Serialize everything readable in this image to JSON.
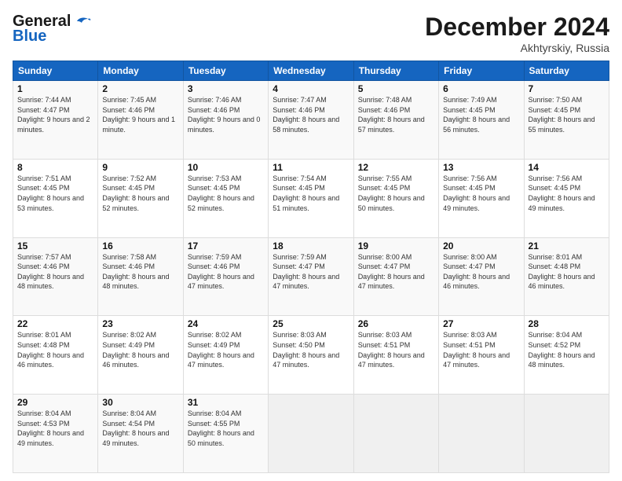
{
  "header": {
    "logo_line1": "General",
    "logo_line2": "Blue",
    "month": "December 2024",
    "location": "Akhtyrskiy, Russia"
  },
  "weekdays": [
    "Sunday",
    "Monday",
    "Tuesday",
    "Wednesday",
    "Thursday",
    "Friday",
    "Saturday"
  ],
  "weeks": [
    [
      {
        "day": "1",
        "sunrise": "Sunrise: 7:44 AM",
        "sunset": "Sunset: 4:47 PM",
        "daylight": "Daylight: 9 hours and 2 minutes."
      },
      {
        "day": "2",
        "sunrise": "Sunrise: 7:45 AM",
        "sunset": "Sunset: 4:46 PM",
        "daylight": "Daylight: 9 hours and 1 minute."
      },
      {
        "day": "3",
        "sunrise": "Sunrise: 7:46 AM",
        "sunset": "Sunset: 4:46 PM",
        "daylight": "Daylight: 9 hours and 0 minutes."
      },
      {
        "day": "4",
        "sunrise": "Sunrise: 7:47 AM",
        "sunset": "Sunset: 4:46 PM",
        "daylight": "Daylight: 8 hours and 58 minutes."
      },
      {
        "day": "5",
        "sunrise": "Sunrise: 7:48 AM",
        "sunset": "Sunset: 4:46 PM",
        "daylight": "Daylight: 8 hours and 57 minutes."
      },
      {
        "day": "6",
        "sunrise": "Sunrise: 7:49 AM",
        "sunset": "Sunset: 4:45 PM",
        "daylight": "Daylight: 8 hours and 56 minutes."
      },
      {
        "day": "7",
        "sunrise": "Sunrise: 7:50 AM",
        "sunset": "Sunset: 4:45 PM",
        "daylight": "Daylight: 8 hours and 55 minutes."
      }
    ],
    [
      {
        "day": "8",
        "sunrise": "Sunrise: 7:51 AM",
        "sunset": "Sunset: 4:45 PM",
        "daylight": "Daylight: 8 hours and 53 minutes."
      },
      {
        "day": "9",
        "sunrise": "Sunrise: 7:52 AM",
        "sunset": "Sunset: 4:45 PM",
        "daylight": "Daylight: 8 hours and 52 minutes."
      },
      {
        "day": "10",
        "sunrise": "Sunrise: 7:53 AM",
        "sunset": "Sunset: 4:45 PM",
        "daylight": "Daylight: 8 hours and 52 minutes."
      },
      {
        "day": "11",
        "sunrise": "Sunrise: 7:54 AM",
        "sunset": "Sunset: 4:45 PM",
        "daylight": "Daylight: 8 hours and 51 minutes."
      },
      {
        "day": "12",
        "sunrise": "Sunrise: 7:55 AM",
        "sunset": "Sunset: 4:45 PM",
        "daylight": "Daylight: 8 hours and 50 minutes."
      },
      {
        "day": "13",
        "sunrise": "Sunrise: 7:56 AM",
        "sunset": "Sunset: 4:45 PM",
        "daylight": "Daylight: 8 hours and 49 minutes."
      },
      {
        "day": "14",
        "sunrise": "Sunrise: 7:56 AM",
        "sunset": "Sunset: 4:45 PM",
        "daylight": "Daylight: 8 hours and 49 minutes."
      }
    ],
    [
      {
        "day": "15",
        "sunrise": "Sunrise: 7:57 AM",
        "sunset": "Sunset: 4:46 PM",
        "daylight": "Daylight: 8 hours and 48 minutes."
      },
      {
        "day": "16",
        "sunrise": "Sunrise: 7:58 AM",
        "sunset": "Sunset: 4:46 PM",
        "daylight": "Daylight: 8 hours and 48 minutes."
      },
      {
        "day": "17",
        "sunrise": "Sunrise: 7:59 AM",
        "sunset": "Sunset: 4:46 PM",
        "daylight": "Daylight: 8 hours and 47 minutes."
      },
      {
        "day": "18",
        "sunrise": "Sunrise: 7:59 AM",
        "sunset": "Sunset: 4:47 PM",
        "daylight": "Daylight: 8 hours and 47 minutes."
      },
      {
        "day": "19",
        "sunrise": "Sunrise: 8:00 AM",
        "sunset": "Sunset: 4:47 PM",
        "daylight": "Daylight: 8 hours and 47 minutes."
      },
      {
        "day": "20",
        "sunrise": "Sunrise: 8:00 AM",
        "sunset": "Sunset: 4:47 PM",
        "daylight": "Daylight: 8 hours and 46 minutes."
      },
      {
        "day": "21",
        "sunrise": "Sunrise: 8:01 AM",
        "sunset": "Sunset: 4:48 PM",
        "daylight": "Daylight: 8 hours and 46 minutes."
      }
    ],
    [
      {
        "day": "22",
        "sunrise": "Sunrise: 8:01 AM",
        "sunset": "Sunset: 4:48 PM",
        "daylight": "Daylight: 8 hours and 46 minutes."
      },
      {
        "day": "23",
        "sunrise": "Sunrise: 8:02 AM",
        "sunset": "Sunset: 4:49 PM",
        "daylight": "Daylight: 8 hours and 46 minutes."
      },
      {
        "day": "24",
        "sunrise": "Sunrise: 8:02 AM",
        "sunset": "Sunset: 4:49 PM",
        "daylight": "Daylight: 8 hours and 47 minutes."
      },
      {
        "day": "25",
        "sunrise": "Sunrise: 8:03 AM",
        "sunset": "Sunset: 4:50 PM",
        "daylight": "Daylight: 8 hours and 47 minutes."
      },
      {
        "day": "26",
        "sunrise": "Sunrise: 8:03 AM",
        "sunset": "Sunset: 4:51 PM",
        "daylight": "Daylight: 8 hours and 47 minutes."
      },
      {
        "day": "27",
        "sunrise": "Sunrise: 8:03 AM",
        "sunset": "Sunset: 4:51 PM",
        "daylight": "Daylight: 8 hours and 47 minutes."
      },
      {
        "day": "28",
        "sunrise": "Sunrise: 8:04 AM",
        "sunset": "Sunset: 4:52 PM",
        "daylight": "Daylight: 8 hours and 48 minutes."
      }
    ],
    [
      {
        "day": "29",
        "sunrise": "Sunrise: 8:04 AM",
        "sunset": "Sunset: 4:53 PM",
        "daylight": "Daylight: 8 hours and 49 minutes."
      },
      {
        "day": "30",
        "sunrise": "Sunrise: 8:04 AM",
        "sunset": "Sunset: 4:54 PM",
        "daylight": "Daylight: 8 hours and 49 minutes."
      },
      {
        "day": "31",
        "sunrise": "Sunrise: 8:04 AM",
        "sunset": "Sunset: 4:55 PM",
        "daylight": "Daylight: 8 hours and 50 minutes."
      },
      null,
      null,
      null,
      null
    ]
  ]
}
